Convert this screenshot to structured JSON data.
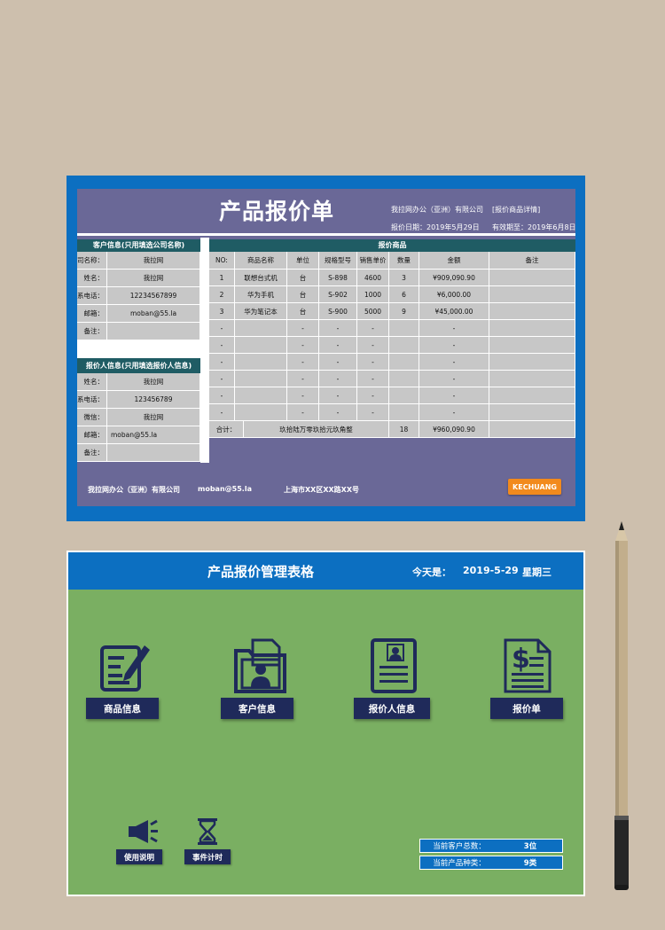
{
  "quote": {
    "title": "产品报价单",
    "company": "我拉网办公（亚洲）有限公司",
    "detail_link": "[报价商品详情]",
    "quote_date": "报价日期：2019年5月29日",
    "valid_until": "有效期至：2019年6月8日",
    "customer_section": "客户信息(只用填选公司名称)",
    "customer": [
      {
        "label": "公司名称：",
        "value": "我拉网"
      },
      {
        "label": "姓名：",
        "value": "我拉网"
      },
      {
        "label": "联系电话：",
        "value": "12234567899"
      },
      {
        "label": "邮箱：",
        "value": "moban@55.la"
      },
      {
        "label": "备注：",
        "value": ""
      }
    ],
    "quoter_section": "报价人信息(只用填选报价人信息)",
    "quoter": [
      {
        "label": "姓名：",
        "value": "我拉网"
      },
      {
        "label": "联系电话：",
        "value": "123456789"
      },
      {
        "label": "微信：",
        "value": "我拉网"
      },
      {
        "label": "邮箱：",
        "value": "moban@55.la"
      },
      {
        "label": "备注：",
        "value": ""
      }
    ],
    "goods_section": "报价商品",
    "columns": [
      "NO:",
      "商品名称",
      "单位",
      "规格型号",
      "销售单价",
      "数量",
      "金额",
      "备注"
    ],
    "rows": [
      [
        "1",
        "联想台式机",
        "台",
        "S-898",
        "4600",
        "3",
        "¥909,090.90",
        ""
      ],
      [
        "2",
        "华为手机",
        "台",
        "S-902",
        "1000",
        "6",
        "¥6,000.00",
        ""
      ],
      [
        "3",
        "华为笔记本",
        "台",
        "S-900",
        "5000",
        "9",
        "¥45,000.00",
        ""
      ],
      [
        "-",
        "",
        "-",
        "-",
        "-",
        "",
        "-",
        ""
      ],
      [
        "-",
        "",
        "-",
        "-",
        "-",
        "",
        "-",
        ""
      ],
      [
        "-",
        "",
        "-",
        "-",
        "-",
        "",
        "-",
        ""
      ],
      [
        "-",
        "",
        "-",
        "-",
        "-",
        "",
        "-",
        ""
      ],
      [
        "-",
        "",
        "-",
        "-",
        "-",
        "",
        "-",
        ""
      ],
      [
        "-",
        "",
        "-",
        "-",
        "-",
        "",
        "-",
        ""
      ]
    ],
    "total_label": "合计：",
    "total_words": "玖拾陆万零玖拾元玖角整",
    "total_qty": "18",
    "total_amount": "¥960,090.90",
    "footer_company": "我拉网办公（亚洲）有限公司",
    "footer_email": "moban@55.la",
    "footer_address": "上海市XX区XX路XX号",
    "footer_button": "KECHUANG"
  },
  "dashboard": {
    "title": "产品报价管理表格",
    "today_label": "今天是：",
    "date": "2019-5-29",
    "weekday": "星期三",
    "nav": [
      "商品信息",
      "客户信息",
      "报价人信息",
      "报价单"
    ],
    "tools": [
      "使用说明",
      "事件计时"
    ],
    "stats": [
      {
        "label": "当前客户总数：",
        "value": "3位"
      },
      {
        "label": "当前产品种类：",
        "value": "9类"
      }
    ]
  }
}
